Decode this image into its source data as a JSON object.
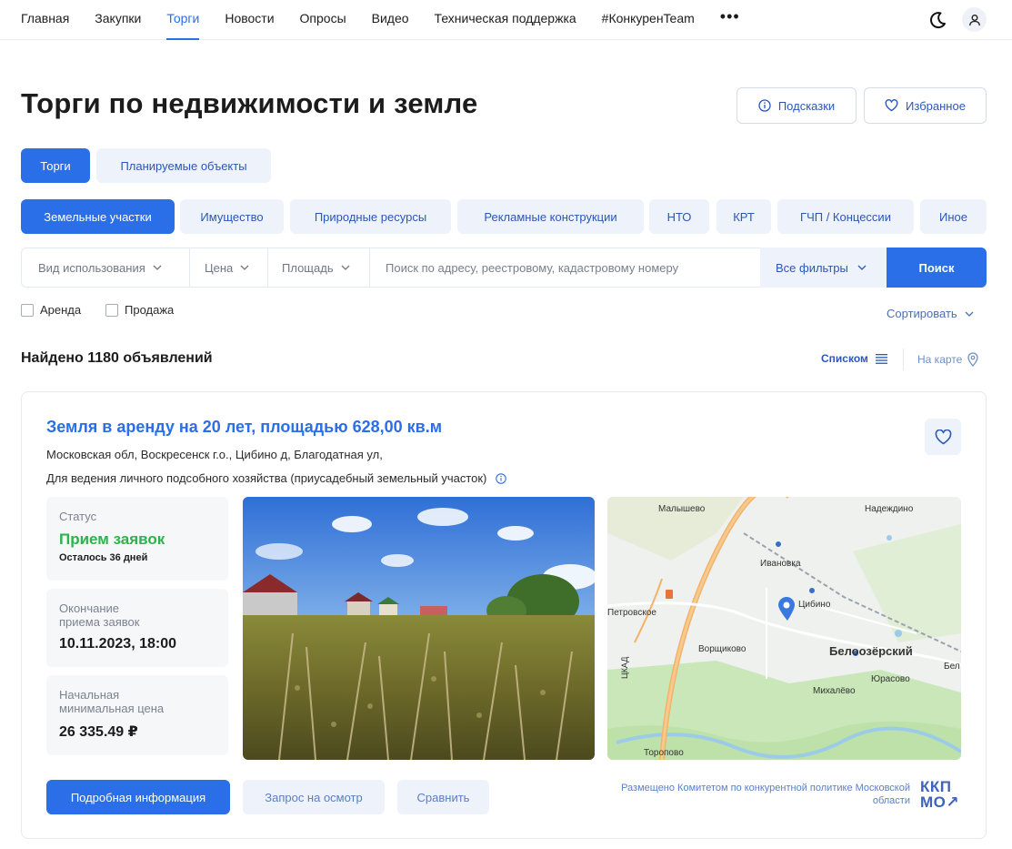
{
  "nav": {
    "items": [
      {
        "label": "Главная",
        "active": false
      },
      {
        "label": "Закупки",
        "active": false
      },
      {
        "label": "Торги",
        "active": true
      },
      {
        "label": "Новости",
        "active": false
      },
      {
        "label": "Опросы",
        "active": false
      },
      {
        "label": "Видео",
        "active": false
      },
      {
        "label": "Техническая поддержка",
        "active": false
      },
      {
        "label": "#КонкуренTeam",
        "active": false
      }
    ],
    "more": "•••",
    "icons": {
      "theme": "moon-icon",
      "user": "user-icon"
    }
  },
  "page": {
    "title": "Торги по недвижимости и земле",
    "hints_label": "Подсказки",
    "favorites_label": "Избранное"
  },
  "tabs": {
    "main": [
      {
        "label": "Торги",
        "active": true
      },
      {
        "label": "Планируемые объекты",
        "active": false
      }
    ],
    "categories": [
      {
        "label": "Земельные участки",
        "active": true
      },
      {
        "label": "Имущество",
        "active": false
      },
      {
        "label": "Природные ресурсы",
        "active": false
      },
      {
        "label": "Рекламные конструкции",
        "active": false
      },
      {
        "label": "НТО",
        "active": false
      },
      {
        "label": "КРТ",
        "active": false
      },
      {
        "label": "ГЧП / Концессии",
        "active": false
      },
      {
        "label": "Иное",
        "active": false
      }
    ]
  },
  "filters": {
    "use": "Вид использования",
    "price": "Цена",
    "area": "Площадь",
    "search_placeholder": "Поиск по адресу, реестровому, кадастровому номеру",
    "search_value": "",
    "all_filters": "Все фильтры",
    "search_button": "Поиск",
    "rent": "Аренда",
    "sale": "Продажа",
    "sort": "Сортировать"
  },
  "results": {
    "found": "Найдено 1180 объявлений",
    "list_view": "Списком",
    "map_view": "На карте"
  },
  "card": {
    "title": "Земля в аренду на 20 лет, площадью 628,00 кв.м",
    "address": "Московская обл, Воскресенск г.о., Цибино д, Благодатная ул,",
    "purpose": "Для ведения личного подсобного хозяйства (приусадебный земельный участок)",
    "status_label": "Статус",
    "status_value": "Прием заявок",
    "status_remaining": "Осталось 36 дней",
    "deadline_label": "Окончание приема заявок",
    "deadline_value": "10.11.2023, 18:00",
    "price_label": "Начальная минимальная цена",
    "price_value": "26 335.49 ₽",
    "btn_detail": "Подробная информация",
    "btn_request": "Запрос на осмотр",
    "btn_compare": "Сравнить",
    "posted_by": "Размещено Комитетом по конкурентной политике Московской области",
    "logo_line1": "ККП",
    "logo_line2": "МО↗",
    "map_labels": [
      "Малышево",
      "Надеждино",
      "Ивановка",
      "Петровское",
      "Цибино",
      "Ворщиково",
      "Белоозёрский",
      "Бел",
      "ЦКАД",
      "Юрасово",
      "Михалёво",
      "Торопово"
    ]
  },
  "colors": {
    "accent": "#2a6ee8",
    "status_green": "#2db34a",
    "pill_bg": "#eef2fa"
  }
}
